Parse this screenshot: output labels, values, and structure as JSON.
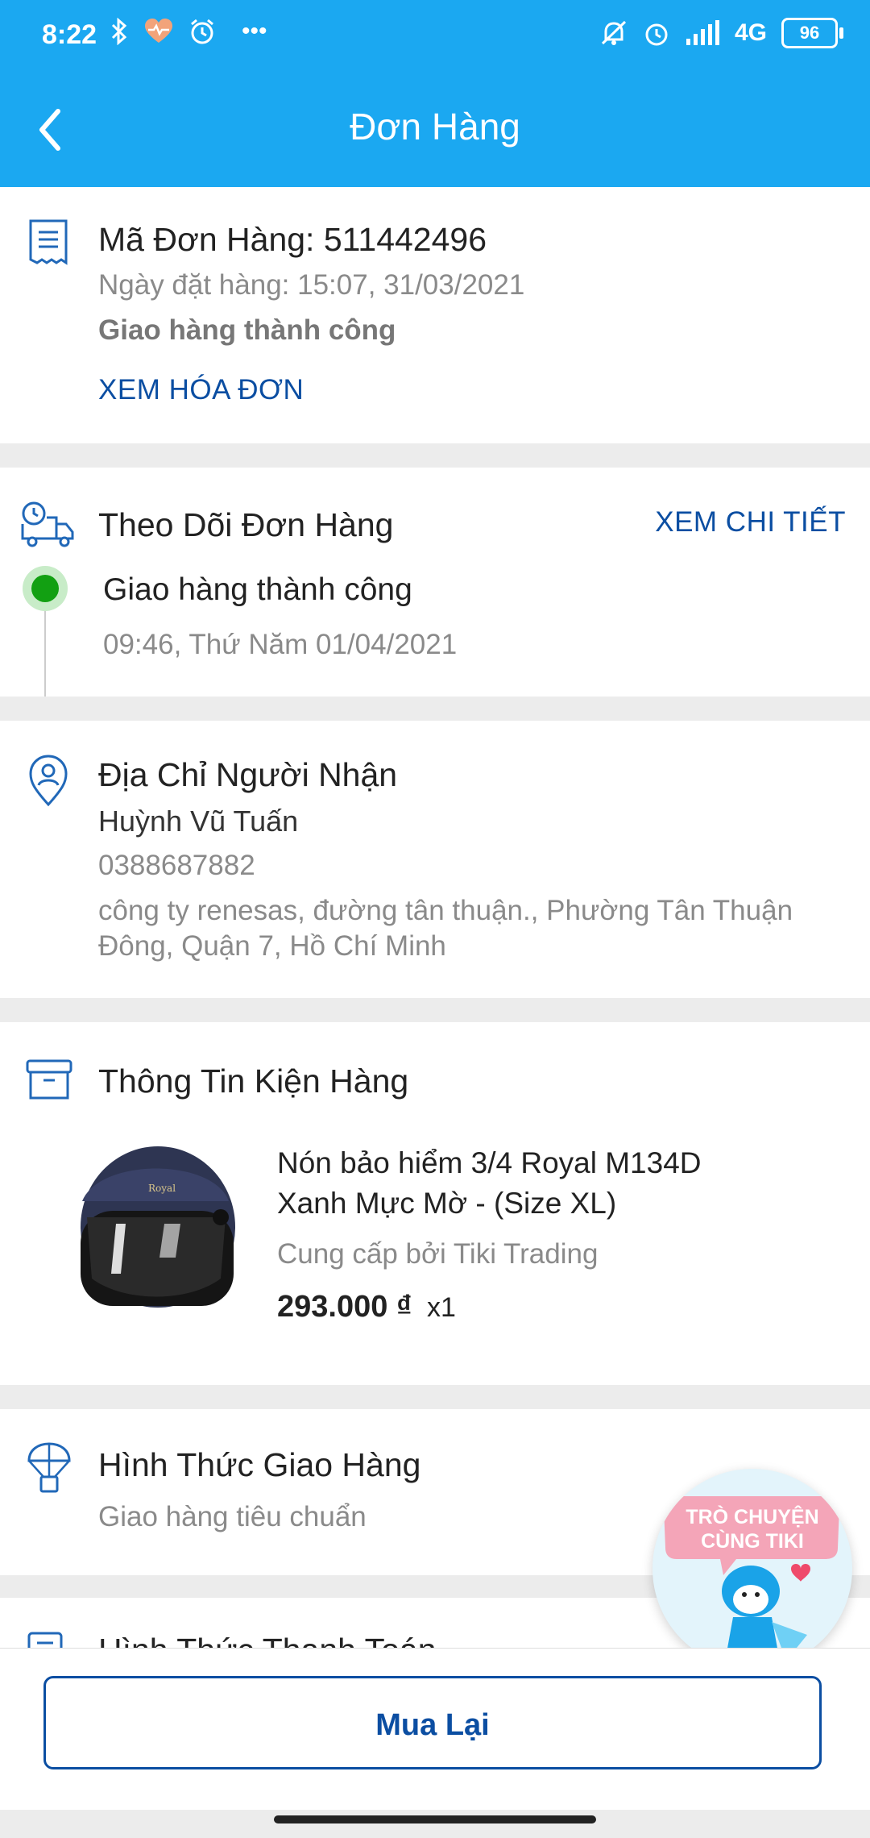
{
  "status_bar": {
    "time": "8:22",
    "network": "4G",
    "battery": "96"
  },
  "header": {
    "title": "Đơn Hàng"
  },
  "order": {
    "code_label": "Mã Đơn Hàng: 511442496",
    "order_date": "Ngày đặt hàng: 15:07, 31/03/2021",
    "status": "Giao hàng thành công",
    "invoice_link": "XEM HÓA ĐƠN"
  },
  "tracking": {
    "title": "Theo Dõi Đơn Hàng",
    "detail_link": "XEM CHI TIẾT",
    "event_status": "Giao hàng thành công",
    "event_time": "09:46, Thứ Năm 01/04/2021"
  },
  "recipient": {
    "title": "Địa Chỉ Người Nhận",
    "name": "Huỳnh Vũ Tuấn",
    "phone": "0388687882",
    "address": "công ty renesas, đường tân thuận., Phường Tân Thuận Đông, Quận 7, Hồ Chí Minh"
  },
  "package": {
    "title": "Thông Tin Kiện Hàng",
    "product_name": "Nón bảo hiểm 3/4 Royal M134D Xanh Mực Mờ - (Size XL)",
    "seller": "Cung cấp bởi Tiki Trading",
    "price": "293.000 ₫",
    "quantity": "x1"
  },
  "shipping": {
    "title": "Hình Thức Giao Hàng",
    "method": "Giao hàng tiêu chuẩn"
  },
  "payment": {
    "title": "Hình Thức Thanh Toán"
  },
  "chat": {
    "label_line1": "TRÒ CHUYỆN",
    "label_line2": "CÙNG TIKI"
  },
  "actions": {
    "buy_again": "Mua Lại"
  },
  "colors": {
    "header_bg": "#1ba8f1",
    "link": "#0b4ea2",
    "success": "#12a012"
  }
}
